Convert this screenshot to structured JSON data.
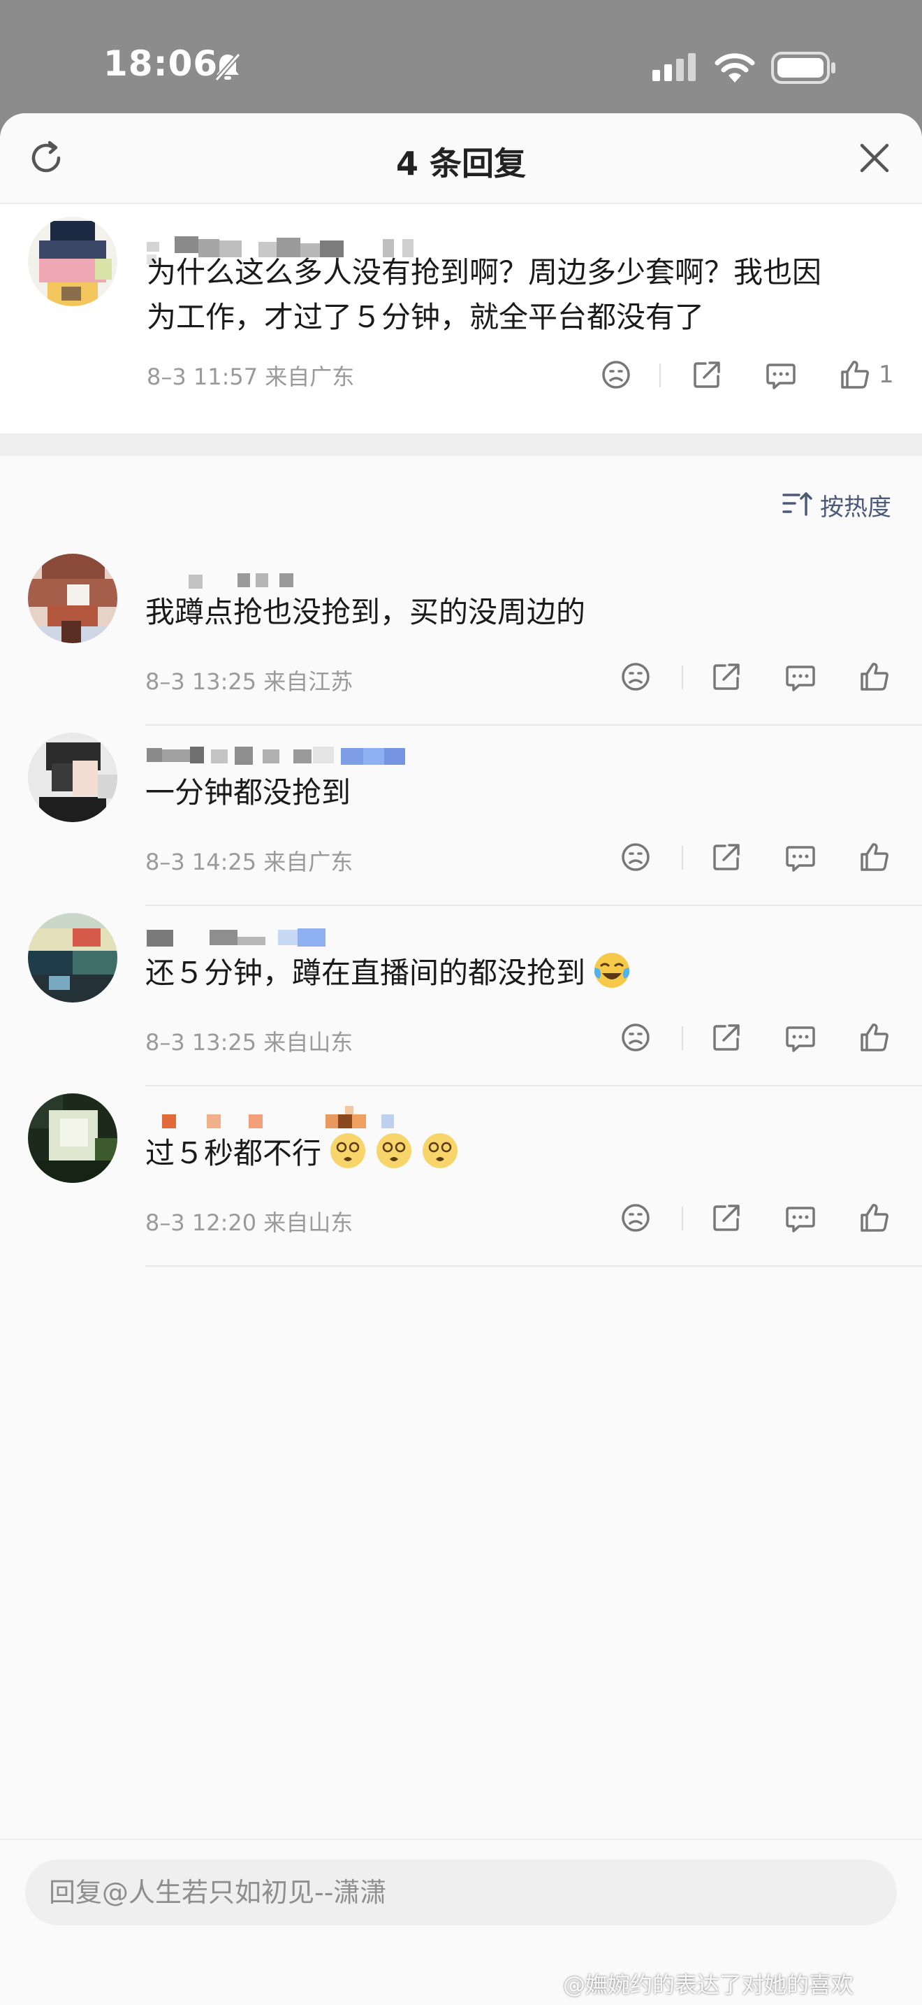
{
  "status_bar": {
    "time": "18:06"
  },
  "header": {
    "title": "4 条回复"
  },
  "main_comment": {
    "text_line1": "为什么这么多人没有抢到啊？周边多少套啊？我也因",
    "text_line2": "为工作，才过了５分钟，就全平台都没有了",
    "meta": "8–3 11:57  来自广东",
    "like_count": "1"
  },
  "sort": {
    "label": "按热度"
  },
  "replies": [
    {
      "text": "我蹲点抢也没抢到，买的没周边的",
      "meta": "8–3 13:25  来自江苏"
    },
    {
      "text": "一分钟都没抢到",
      "meta": "8–3 14:25  来自广东"
    },
    {
      "text": "还５分钟，蹲在直播间的都没抢到",
      "meta": "8–3 13:25  来自山东",
      "emoji": "laughing-crying-emoji"
    },
    {
      "text": "过５秒都不行",
      "meta": "8–3 12:20  来自山东",
      "emoji": "dizzy-face-emoji"
    }
  ],
  "input": {
    "placeholder": "回复@人生若只如初见--潇潇"
  },
  "watermark": "@嫵婉约的表达了对她的喜欢",
  "colors": {
    "accent": "#4a5a78",
    "meta": "#9a9a9a",
    "background": "#fafafa"
  }
}
